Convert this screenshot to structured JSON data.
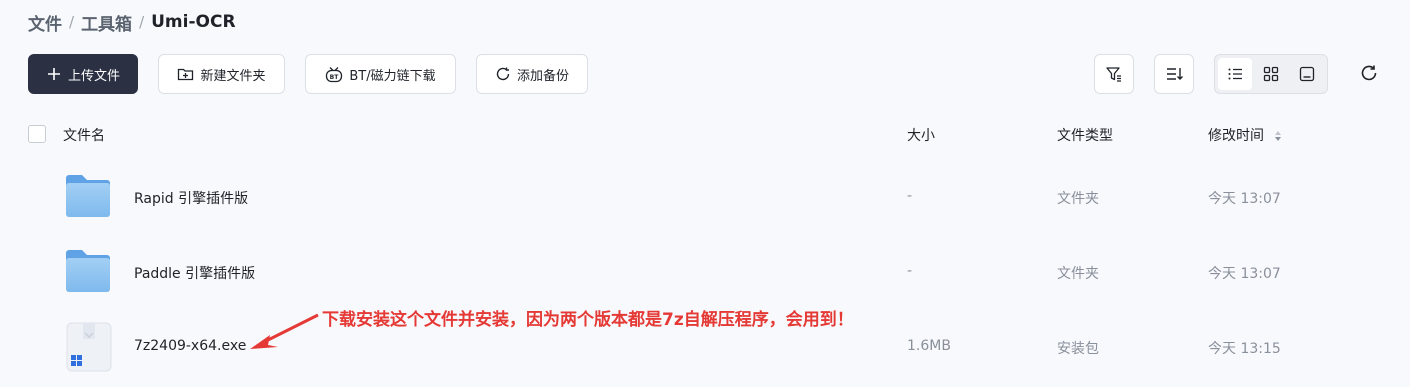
{
  "breadcrumb": {
    "items": [
      "文件",
      "工具箱",
      "Umi-OCR"
    ],
    "separator": "/"
  },
  "toolbar": {
    "upload_label": "上传文件",
    "new_folder_label": "新建文件夹",
    "bt_label": "BT/磁力链下载",
    "backup_label": "添加备份"
  },
  "icons": {
    "upload": "plus-icon",
    "new_folder": "folder-plus-icon",
    "bt": "bt-icon",
    "backup": "sync-icon",
    "filter": "filter-icon",
    "sort": "sort-icon",
    "list_view": "list-view-icon",
    "grid_view": "grid-view-icon",
    "preview_view": "preview-view-icon",
    "refresh": "refresh-icon"
  },
  "colors": {
    "primary_button": "#2b3142",
    "folder_blue": "#7fb9ec",
    "annotation_red": "#e53935"
  },
  "table": {
    "headers": {
      "name": "文件名",
      "size": "大小",
      "type": "文件类型",
      "modified": "修改时间"
    },
    "rows": [
      {
        "name": "Rapid 引擎插件版",
        "size": "-",
        "type": "文件夹",
        "modified": "今天 13:07",
        "icon": "folder-icon"
      },
      {
        "name": "Paddle 引擎插件版",
        "size": "-",
        "type": "文件夹",
        "modified": "今天 13:07",
        "icon": "folder-icon"
      },
      {
        "name": "7z2409-x64.exe",
        "size": "1.6MB",
        "type": "安装包",
        "modified": "今天 13:15",
        "icon": "installer-icon"
      }
    ]
  },
  "annotation": {
    "text": "下载安装这个文件并安装，因为两个版本都是7z自解压程序，会用到！"
  }
}
